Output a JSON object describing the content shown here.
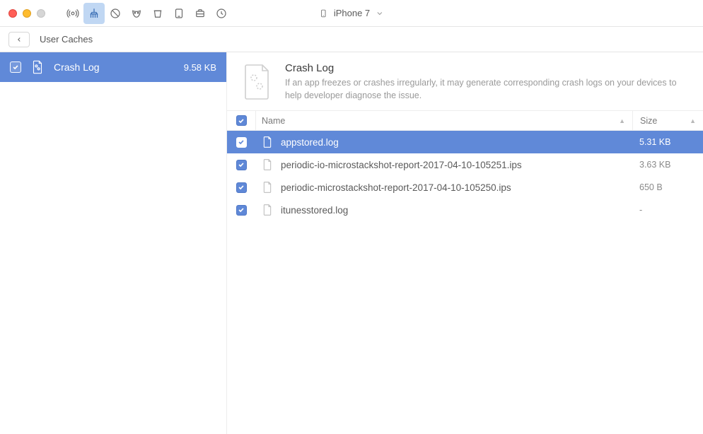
{
  "device": {
    "name": "iPhone 7"
  },
  "breadcrumb": {
    "back_label": "Back",
    "title": "User Caches"
  },
  "sidebar": {
    "items": [
      {
        "label": "Crash Log",
        "size": "9.58 KB"
      }
    ]
  },
  "detail": {
    "title": "Crash Log",
    "description": "If an app freezes or crashes irregularly, it may generate corresponding crash logs on your devices to help developer diagnose the issue."
  },
  "table": {
    "columns": {
      "name": "Name",
      "size": "Size"
    },
    "rows": [
      {
        "name": "appstored.log",
        "size": "5.31 KB",
        "selected": true,
        "checked": true
      },
      {
        "name": "periodic-io-microstackshot-report-2017-04-10-105251.ips",
        "size": "3.63 KB",
        "selected": false,
        "checked": true
      },
      {
        "name": "periodic-microstackshot-report-2017-04-10-105250.ips",
        "size": "650 B",
        "selected": false,
        "checked": true
      },
      {
        "name": "itunesstored.log",
        "size": "-",
        "selected": false,
        "checked": true
      }
    ]
  }
}
